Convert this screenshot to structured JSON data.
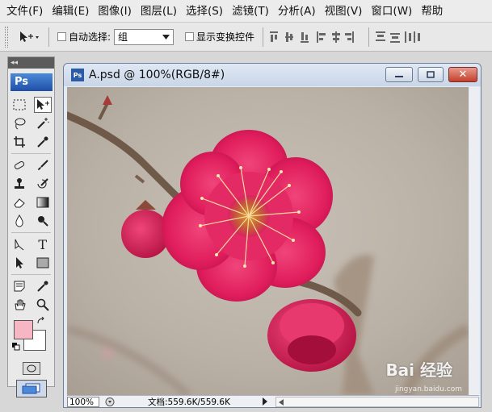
{
  "menubar": {
    "items": [
      "文件(F)",
      "编辑(E)",
      "图像(I)",
      "图层(L)",
      "选择(S)",
      "滤镜(T)",
      "分析(A)",
      "视图(V)",
      "窗口(W)",
      "帮助"
    ]
  },
  "options_bar": {
    "auto_select_label": "自动选择:",
    "auto_select_value": "组",
    "show_transform_label": "显示变换控件"
  },
  "toolbox": {
    "logo": "Ps"
  },
  "document": {
    "title": "A.psd @ 100%(RGB/8#)",
    "zoom": "100%",
    "doc_info": "文档:559.6K/559.6K",
    "watermark": "Bai 经验",
    "watermark_sub": "jingyan.baidu.com"
  },
  "colors": {
    "foreground": "#f7b6c3",
    "background": "#ffffff",
    "accent": "#2b5aa6"
  }
}
